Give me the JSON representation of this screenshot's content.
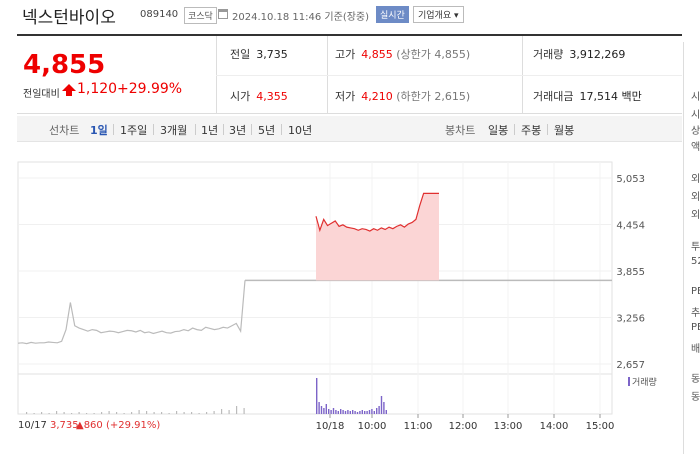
{
  "header": {
    "stock_name": "넥스턴바이오",
    "stock_code": "089140",
    "market": "코스닥",
    "datetime": "2024.10.18 11:46 기준(장중)",
    "realtime": "실시간",
    "company_info": "기업개요"
  },
  "price": {
    "current": "4,855",
    "prev_label": "전일대비",
    "change": "1,120",
    "change_pct": "+29.99%"
  },
  "stats": {
    "prev_close_label": "전일",
    "prev_close": "3,735",
    "open_label": "시가",
    "open": "4,355",
    "high_label": "고가",
    "high": "4,855",
    "upper_limit": "(상한가 4,855)",
    "low_label": "저가",
    "low": "4,210",
    "lower_limit": "(하한가 2,615)",
    "volume_label": "거래량",
    "volume": "3,912,269",
    "amount_label": "거래대금",
    "amount": "17,514",
    "amount_unit": "백만"
  },
  "toolbar": {
    "line_chart": "선차트",
    "periods": [
      "1일",
      "1주일",
      "3개월",
      "1년",
      "3년",
      "5년",
      "10년"
    ],
    "active_period": "1일",
    "candle_chart": "봉차트",
    "candles": [
      "일봉",
      "주봉",
      "월봉"
    ]
  },
  "side_fragments": [
    "시",
    "시",
    "상",
    "액",
    "외",
    "외",
    "외",
    "투",
    "52",
    "PE",
    "추",
    "PE",
    "배",
    "동",
    "동"
  ],
  "chart_data": {
    "type": "line",
    "y_ticks": [
      "5,053",
      "4,454",
      "3,855",
      "3,256",
      "2,657"
    ],
    "ylim": [
      2657,
      5053
    ],
    "x_ticks": [
      "10/18",
      "10:00",
      "11:00",
      "12:00",
      "13:00",
      "14:00",
      "15:00"
    ],
    "volume_label": "거래량",
    "prev_day_info": {
      "date": "10/17",
      "close": "3,735",
      "change": "▲860",
      "pct": "(+29.91%)"
    },
    "prev_day_line": [
      2925,
      2930,
      2920,
      2935,
      2925,
      2930,
      2930,
      2940,
      2935,
      2930,
      2950,
      3100,
      3450,
      3150,
      3120,
      3100,
      3080,
      3100,
      3090,
      3060,
      3070,
      3080,
      3075,
      3060,
      3075,
      3090,
      3085,
      3070,
      3090,
      3060,
      3070,
      3050,
      3065,
      3080,
      3060,
      3055,
      3075,
      3080,
      3100,
      3085,
      3120,
      3100,
      3090,
      3130,
      3115,
      3100,
      3110,
      3130,
      3120,
      3150,
      3180,
      3080,
      3735
    ],
    "today_prev_close": 3735,
    "today_line": [
      4560,
      4380,
      4520,
      4440,
      4470,
      4500,
      4430,
      4450,
      4420,
      4410,
      4400,
      4380,
      4400,
      4390,
      4370,
      4400,
      4380,
      4410,
      4390,
      4420,
      4400,
      4430,
      4450,
      4420,
      4460,
      4480,
      4520,
      4700,
      4855,
      4855,
      4855,
      4855,
      4855
    ],
    "colors": {
      "price_up": "#e03030",
      "fill_up": "#fbd5d5",
      "volume": "#7c64c8",
      "gray_line": "#bbbbbb"
    }
  }
}
